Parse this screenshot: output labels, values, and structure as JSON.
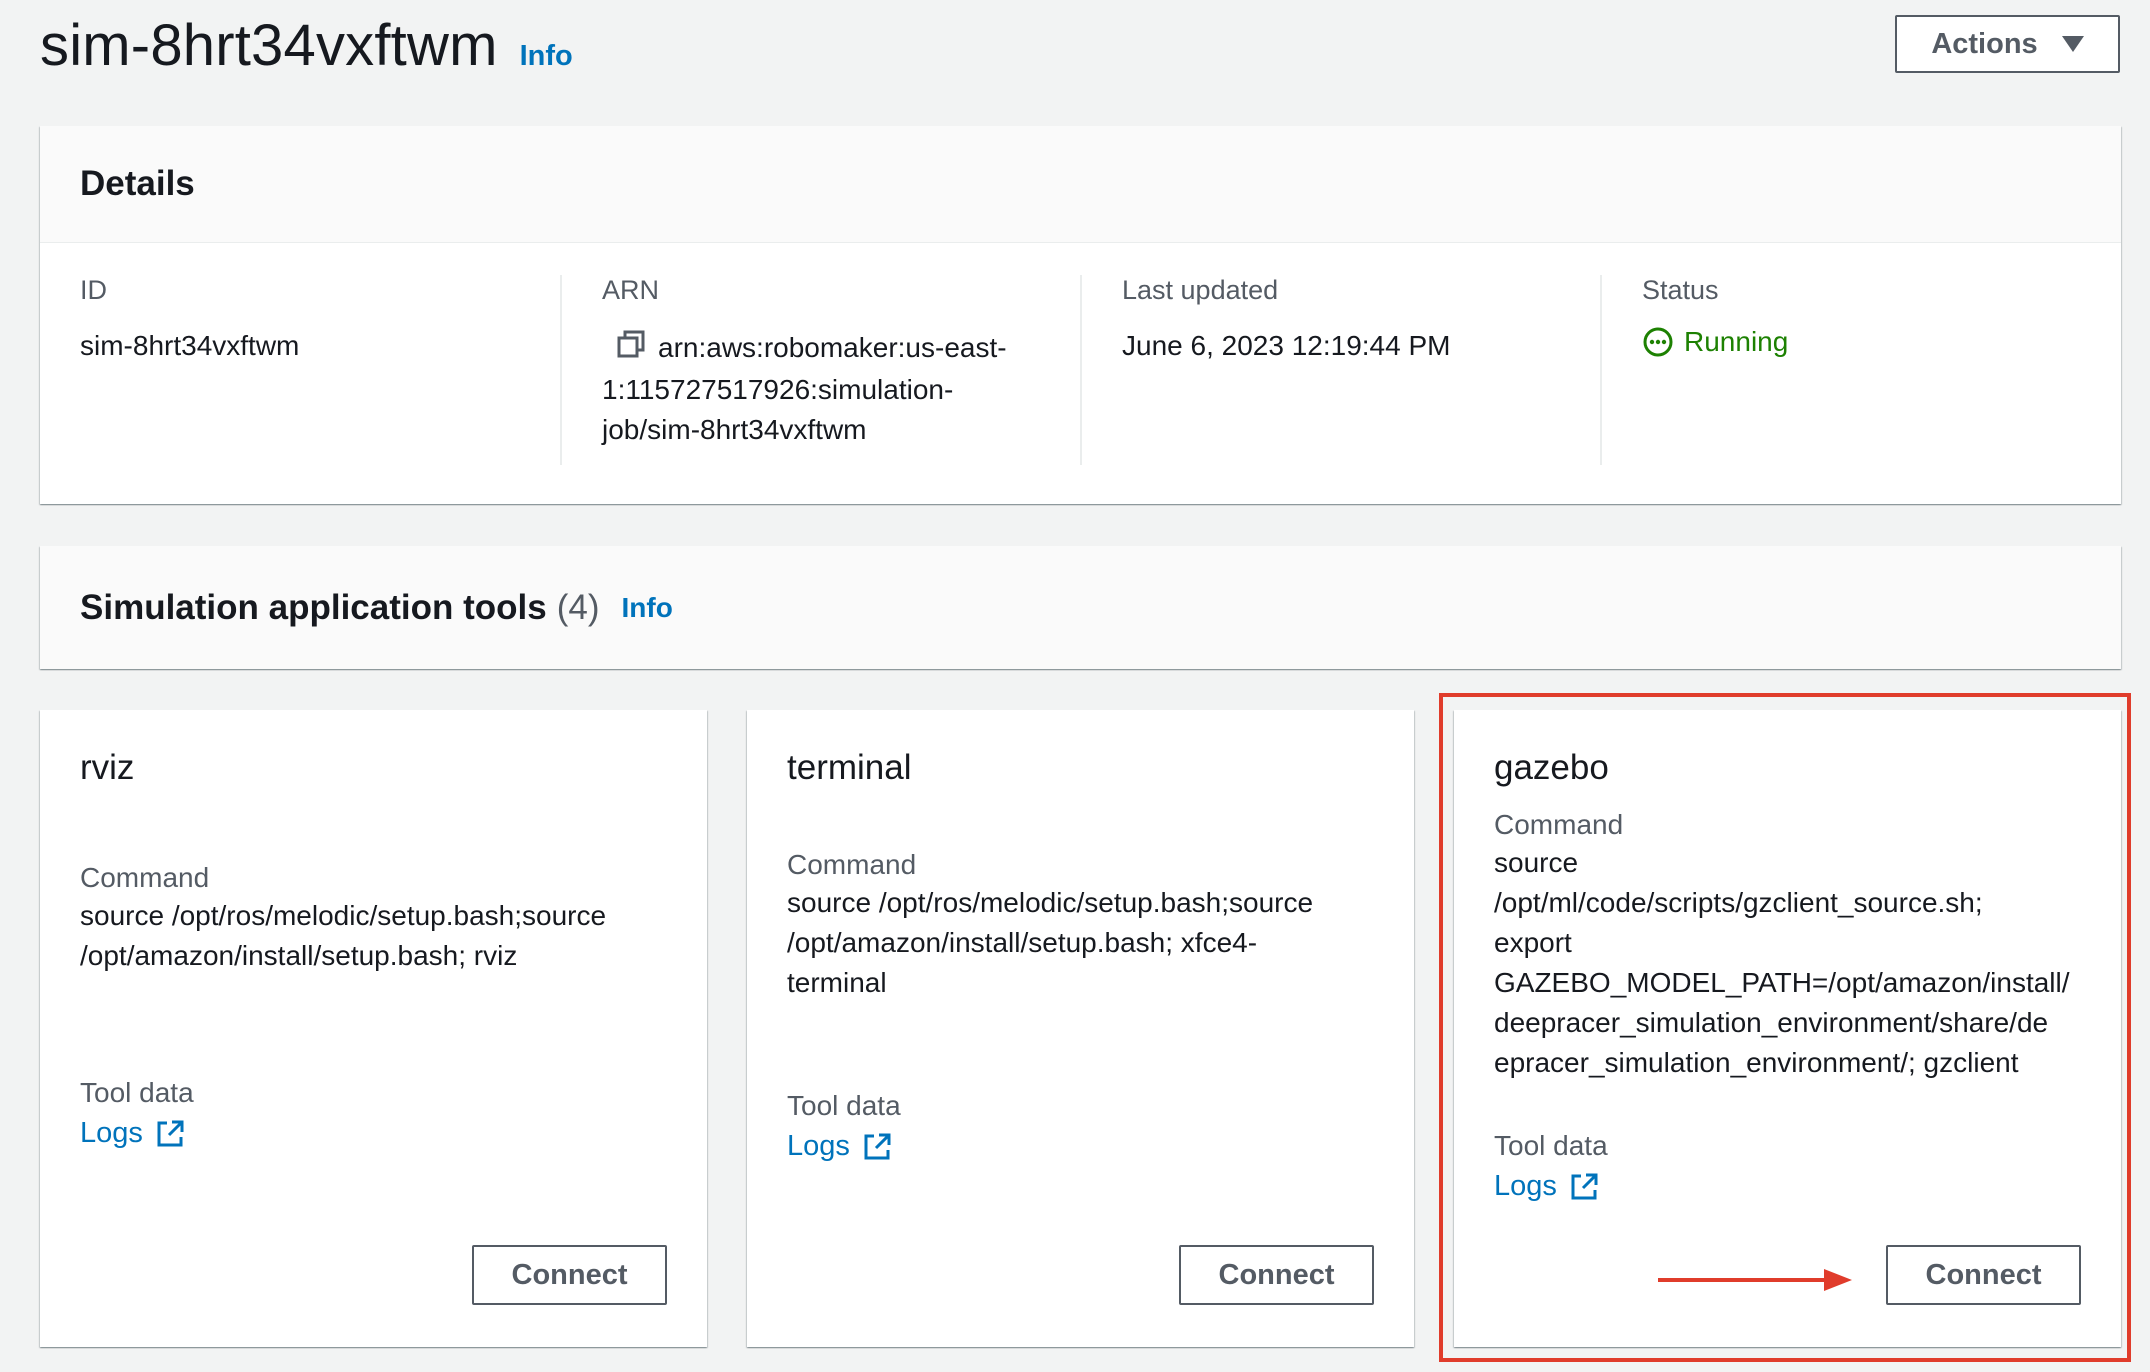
{
  "header": {
    "title": "sim-8hrt34vxftwm",
    "info_label": "Info",
    "actions_label": "Actions"
  },
  "details": {
    "title": "Details",
    "id_label": "ID",
    "id_value": "sim-8hrt34vxftwm",
    "arn_label": "ARN",
    "arn_line1": "arn:aws:robomaker:us-east-",
    "arn_line2": "1:115727517926:simulation-",
    "arn_line3": "job/sim-8hrt34vxftwm",
    "last_updated_label": "Last updated",
    "last_updated_value": "June 6, 2023 12:19:44 PM",
    "status_label": "Status",
    "status_value": "Running",
    "status_color": "#1d8102"
  },
  "tools": {
    "title": "Simulation application tools",
    "count": "(4)",
    "info_label": "Info",
    "command_label": "Command",
    "tool_data_label": "Tool data",
    "logs_label": "Logs",
    "connect_label": "Connect",
    "items": [
      {
        "name": "rviz",
        "command_lines": [
          "source /opt/ros/melodic/setup.bash;source",
          "/opt/amazon/install/setup.bash; rviz"
        ]
      },
      {
        "name": "terminal",
        "command_lines": [
          "source /opt/ros/melodic/setup.bash;source",
          "/opt/amazon/install/setup.bash; xfce4-",
          "terminal"
        ]
      },
      {
        "name": "gazebo",
        "command_lines": [
          "source",
          "/opt/ml/code/scripts/gzclient_source.sh;",
          "export",
          "GAZEBO_MODEL_PATH=/opt/amazon/install/",
          "deepracer_simulation_environment/share/de",
          "epracer_simulation_environment/; gzclient"
        ]
      }
    ]
  },
  "annotation": {
    "highlight_color": "#e03c2b",
    "highlighted_tool": "gazebo"
  }
}
